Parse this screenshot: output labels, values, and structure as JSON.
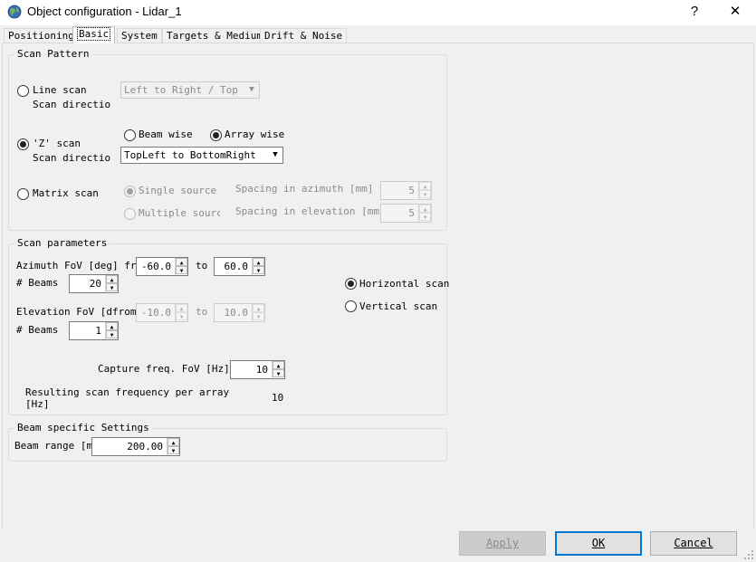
{
  "window": {
    "title": "Object configuration - Lidar_1",
    "help_label": "?",
    "close_label": "✕"
  },
  "tabs": [
    "Positioning",
    "Basic",
    "System",
    "Targets & Medium",
    "Drift & Noise"
  ],
  "scan_pattern": {
    "title": "Scan Pattern",
    "line_scan": {
      "label": "Line scan",
      "direction_label": "Scan directio",
      "direction_value": "Left to Right / Top to"
    },
    "z_scan": {
      "label": "'Z' scan",
      "direction_label": "Scan directio",
      "beam_wise": "Beam wise",
      "array_wise": "Array wise",
      "direction_value": "TopLeft to BottomRight"
    },
    "matrix_scan": {
      "label": "Matrix scan",
      "single_source": "Single source",
      "multiple_source": "Multiple source",
      "spacing_azimuth_label": "Spacing in azimuth [mm]",
      "spacing_azimuth_value": "5",
      "spacing_elevation_label": "Spacing in elevation [mm]",
      "spacing_elevation_value": "5"
    }
  },
  "scan_parameters": {
    "title": "Scan parameters",
    "azimuth_label": "Azimuth FoV [deg] from",
    "azimuth_from": "-60.0",
    "to_label": "to",
    "azimuth_to": "60.0",
    "beams_label": "# Beams",
    "azimuth_beams": "20",
    "elevation_label": "Elevation FoV [de",
    "elevation_from_label": "from",
    "elevation_from": "-10.0",
    "elevation_to": "10.0",
    "elevation_beams": "1",
    "horizontal_scan": "Horizontal scan",
    "vertical_scan": "Vertical scan",
    "capture_label": "Capture freq. FoV [Hz]",
    "capture_value": "10",
    "resulting_label_1": "Resulting scan frequency per array",
    "resulting_label_2": "[Hz]",
    "resulting_value": "10"
  },
  "beam_settings": {
    "title": "Beam specific Settings",
    "range_label": "Beam range [m]",
    "range_value": "200.00"
  },
  "buttons": {
    "apply": "Apply",
    "ok": "OK",
    "cancel": "Cancel"
  },
  "colors": {
    "accent": "#0078d7",
    "window_bg": "#f0f0f0"
  }
}
